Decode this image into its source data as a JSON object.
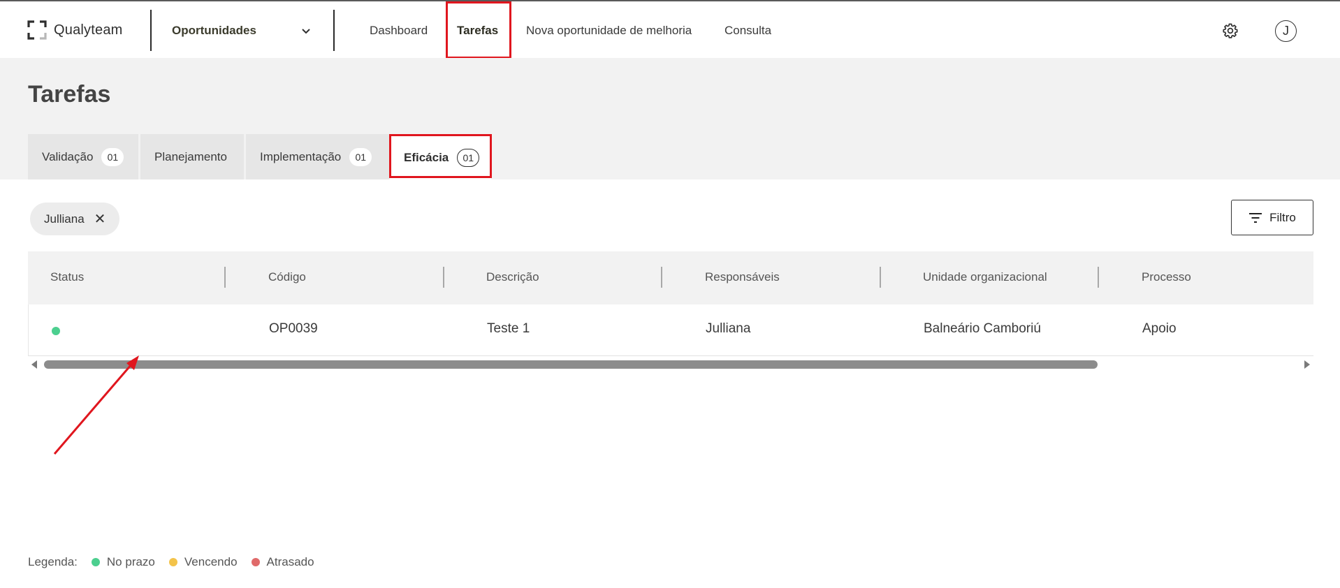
{
  "brand": {
    "name": "Qualyteam"
  },
  "module_select": {
    "value": "Oportunidades"
  },
  "nav": {
    "items": [
      "Dashboard",
      "Tarefas",
      "Nova oportunidade de melhoria",
      "Consulta"
    ],
    "active": "Tarefas"
  },
  "user": {
    "initial": "J"
  },
  "page": {
    "title": "Tarefas"
  },
  "tabs": [
    {
      "label": "Validação",
      "count": "01"
    },
    {
      "label": "Planejamento"
    },
    {
      "label": "Implementação",
      "count": "01"
    },
    {
      "label": "Eficácia",
      "count": "01",
      "active": true
    }
  ],
  "filters": {
    "active_chip": "Julliana",
    "filter_button": "Filtro"
  },
  "table": {
    "columns": [
      "Status",
      "Código",
      "Descrição",
      "Responsáveis",
      "Unidade organizacional",
      "Processo"
    ],
    "rows": [
      {
        "status": "no-prazo",
        "status_color": "#4ccf8f",
        "codigo": "OP0039",
        "descricao": "Teste 1",
        "responsaveis": "Julliana",
        "unidade": "Balneário Camboriú",
        "processo": "Apoio"
      }
    ]
  },
  "legend": {
    "label": "Legenda:",
    "items": [
      {
        "label": "No prazo",
        "color": "#4ccf8f"
      },
      {
        "label": "Vencendo",
        "color": "#f3c34a"
      },
      {
        "label": "Atrasado",
        "color": "#e06a6a"
      }
    ]
  },
  "colors": {
    "highlight": "#e0161e",
    "band_bg": "#f2f2f2",
    "tab_bg": "#e6e6e6"
  },
  "icons": [
    "qualyteam-logo-icon",
    "chevron-down-icon",
    "gear-icon",
    "close-icon",
    "filter-icon"
  ]
}
